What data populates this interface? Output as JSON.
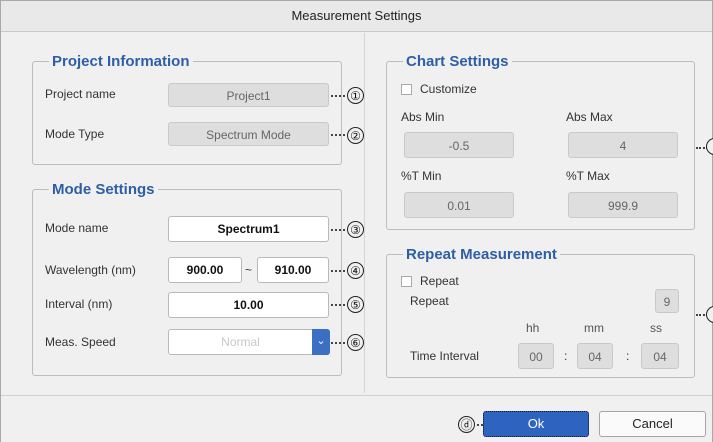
{
  "window": {
    "title": "Measurement Settings"
  },
  "project_info": {
    "legend": "Project Information",
    "project_name_label": "Project name",
    "project_name_value": "Project1",
    "mode_type_label": "Mode Type",
    "mode_type_value": "Spectrum Mode"
  },
  "mode_settings": {
    "legend": "Mode Settings",
    "mode_name_label": "Mode name",
    "mode_name_value": "Spectrum1",
    "wavelength_label": "Wavelength (nm)",
    "wavelength_start": "900.00",
    "wavelength_sep": "~",
    "wavelength_end": "910.00",
    "interval_label": "Interval (nm)",
    "interval_value": "10.00",
    "speed_label": "Meas. Speed",
    "speed_value": "Normal"
  },
  "chart_settings": {
    "legend": "Chart Settings",
    "customize_label": "Customize",
    "customize_checked": false,
    "abs_min_label": "Abs Min",
    "abs_min_value": "-0.5",
    "abs_max_label": "Abs Max",
    "abs_max_value": "4",
    "t_min_label": "%T Min",
    "t_min_value": "0.01",
    "t_max_label": "%T Max",
    "t_max_value": "999.9"
  },
  "repeat": {
    "legend": "Repeat Measurement",
    "repeat_checkbox_label": "Repeat",
    "repeat_checked": false,
    "repeat_label": "Repeat",
    "repeat_value": "9",
    "hh_label": "hh",
    "mm_label": "mm",
    "ss_label": "ss",
    "time_interval_label": "Time Interval",
    "hh_value": "00",
    "mm_value": "04",
    "ss_value": "04",
    "colon": ":"
  },
  "callouts": {
    "c1": "①",
    "c2": "②",
    "c3": "③",
    "c4": "④",
    "c5": "⑤",
    "c6": "⑥",
    "cd": "ⓓ"
  },
  "buttons": {
    "ok": "Ok",
    "cancel": "Cancel"
  },
  "colors": {
    "accent": "#2e5ea5",
    "primary_button": "#2f63c0",
    "dropdown_button": "#3a6fc4"
  }
}
